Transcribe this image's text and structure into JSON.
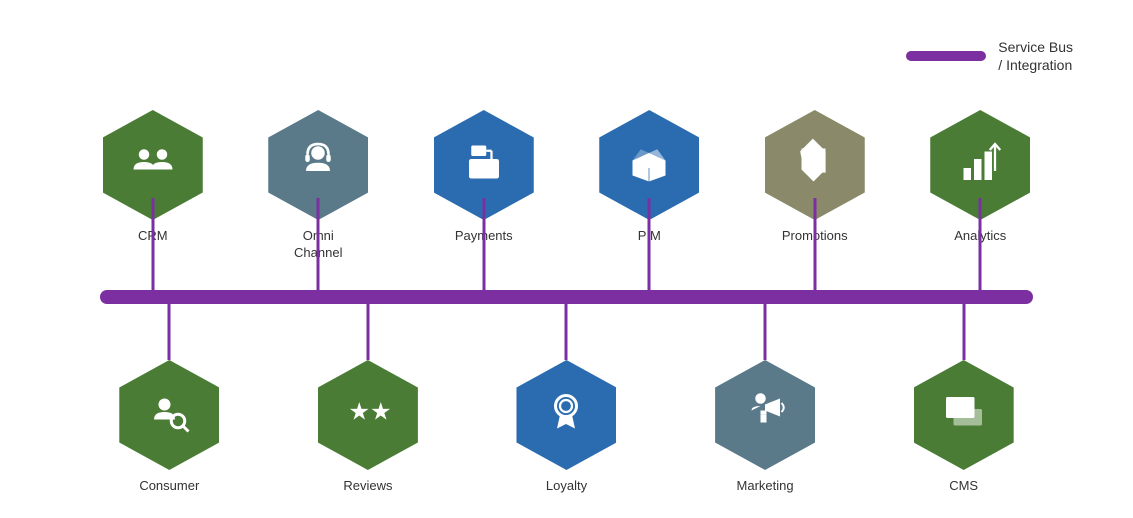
{
  "legend": {
    "label": "Service Bus\n/ Integration",
    "line_color": "#7b2fa0"
  },
  "top_items": [
    {
      "id": "crm",
      "label": "CRM",
      "color": "green",
      "icon": "people"
    },
    {
      "id": "omnichannel",
      "label": "Omni\nChannel",
      "color": "blue-gray",
      "icon": "headset"
    },
    {
      "id": "payments",
      "label": "Payments",
      "color": "blue",
      "icon": "register"
    },
    {
      "id": "pim",
      "label": "PIM",
      "color": "blue",
      "icon": "box"
    },
    {
      "id": "promotions",
      "label": "Promotions",
      "color": "tan",
      "icon": "tag"
    },
    {
      "id": "analytics",
      "label": "Analytics",
      "color": "green",
      "icon": "chart"
    }
  ],
  "bottom_items": [
    {
      "id": "consumer",
      "label": "Consumer",
      "color": "green",
      "icon": "search-person"
    },
    {
      "id": "reviews",
      "label": "Reviews",
      "color": "green",
      "icon": "stars"
    },
    {
      "id": "loyalty",
      "label": "Loyalty",
      "color": "blue",
      "icon": "medal"
    },
    {
      "id": "marketing",
      "label": "Marketing",
      "color": "blue-gray",
      "icon": "megaphone"
    },
    {
      "id": "cms",
      "label": "CMS",
      "color": "green",
      "icon": "images"
    }
  ],
  "service_bus_label": "Service Bus / Integration"
}
